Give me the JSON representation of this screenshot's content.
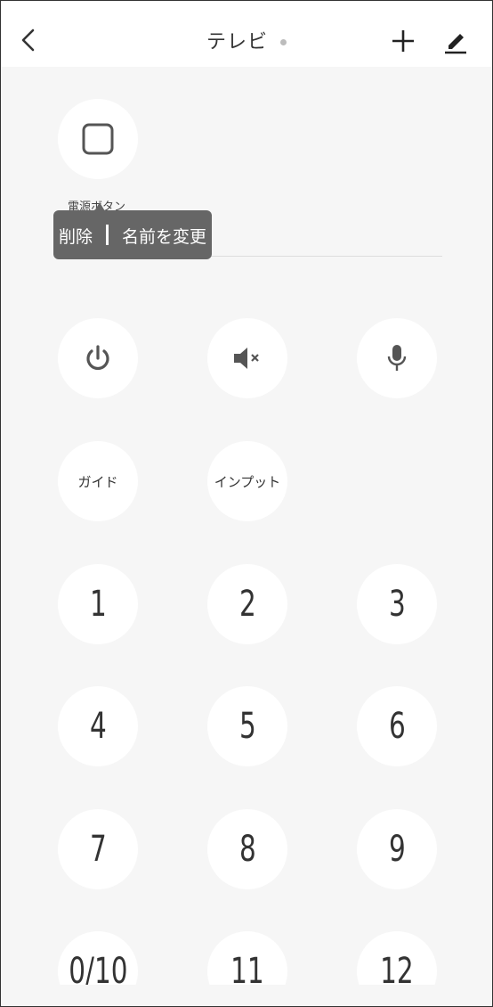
{
  "header": {
    "title": "テレビ"
  },
  "custom_button": {
    "label": "電源ボタン"
  },
  "context_menu": {
    "delete": "削除",
    "rename": "名前を変更"
  },
  "row1": {
    "power": "power-icon",
    "mute": "mute-icon",
    "mic": "microphone-icon"
  },
  "row2": {
    "guide": "ガイド",
    "input": "インプット"
  },
  "numbers": [
    "1",
    "2",
    "3",
    "4",
    "5",
    "6",
    "7",
    "8",
    "9",
    "0/10",
    "11",
    "12"
  ]
}
